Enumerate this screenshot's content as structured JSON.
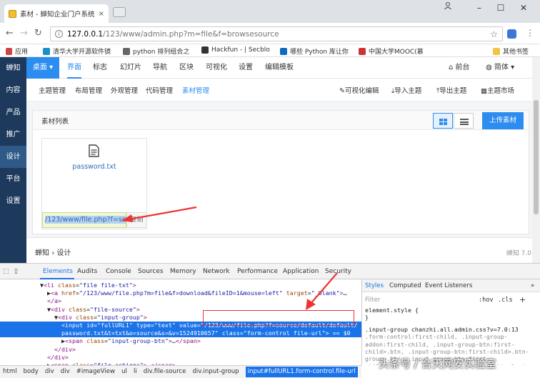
{
  "browser": {
    "tab_title": "素材 - 蝉知企业门户系统",
    "tab_close": "×",
    "url_host": "127.0.0.1",
    "url_path": "/123/www/admin.php?m=file&f=browsesource",
    "win_min": "–",
    "win_max": "☐",
    "win_close": "✕",
    "bookmarks": [
      "应用",
      "清华大学开源软件镜",
      "python 排列组合之",
      "Hackfun - | Secblo",
      "哪些 Python 库让你",
      "中国大学MOOC(慕",
      "其他书签"
    ]
  },
  "sidebar": {
    "brand": "蝉知",
    "items": [
      "内容",
      "产品",
      "推广",
      "设计",
      "平台",
      "设置"
    ]
  },
  "topnav": {
    "brand_tab": "桌面 ▾",
    "items": [
      "界面",
      "标志",
      "幻灯片",
      "导航",
      "区块",
      "可视化",
      "设置",
      "编辑模板"
    ],
    "front": "前台",
    "lang": "简体 ▾"
  },
  "subnav": {
    "items": [
      "主题管理",
      "布局管理",
      "外观管理",
      "代码管理",
      "素材管理"
    ],
    "actions": [
      "可视化编辑",
      "导入主题",
      "导出主题",
      "主题市场"
    ]
  },
  "panel": {
    "title": "素材列表",
    "upload": "上传素材",
    "file_name": "password.txt",
    "file_url": "/123/www/file.php?f=so",
    "copy": "复制"
  },
  "footer": {
    "crumb_brand": "蝉知",
    "crumb_sep": "›",
    "crumb_page": "设计",
    "version": "蝉知 7.0"
  },
  "devtools": {
    "tabs": [
      "Elements",
      "Audits",
      "Console",
      "Sources",
      "Memory",
      "Network",
      "Performance",
      "Application",
      "Security"
    ],
    "lines": [
      {
        "i": 0,
        "parts": [
          [
            "tx",
            "▼"
          ],
          [
            "tg",
            "<li "
          ],
          [
            "an",
            "class"
          ],
          [
            "tx",
            "="
          ],
          [
            "av",
            "\"file file-txt\""
          ],
          [
            "tg",
            ">"
          ]
        ]
      },
      {
        "i": 1,
        "parts": [
          [
            "tx",
            "▶"
          ],
          [
            "tg",
            "<a "
          ],
          [
            "an",
            "href"
          ],
          [
            "tx",
            "="
          ],
          [
            "av",
            "\"/123/www/file.php?m=file&f=download&fileID=1&mouse=left\""
          ],
          [
            "an",
            " target"
          ],
          [
            "tx",
            "="
          ],
          [
            "av",
            "\"_blank\""
          ],
          [
            "tg",
            ">"
          ],
          [
            "tx",
            "…"
          ]
        ]
      },
      {
        "i": 1,
        "parts": [
          [
            "tg",
            "</a>"
          ]
        ]
      },
      {
        "i": 1,
        "parts": [
          [
            "tx",
            "▼"
          ],
          [
            "tg",
            "<div "
          ],
          [
            "an",
            "class"
          ],
          [
            "tx",
            "="
          ],
          [
            "av",
            "\"file-source\""
          ],
          [
            "tg",
            ">"
          ]
        ]
      },
      {
        "i": 2,
        "parts": [
          [
            "tx",
            "▼"
          ],
          [
            "tg",
            "<div "
          ],
          [
            "an",
            "class"
          ],
          [
            "tx",
            "="
          ],
          [
            "av",
            "\"input-group\""
          ],
          [
            "tg",
            ">"
          ]
        ]
      },
      {
        "i": 3,
        "parts": [
          [
            "tg",
            "<input "
          ],
          [
            "an",
            "id"
          ],
          [
            "tx",
            "="
          ],
          [
            "av",
            "\"fullURL1\""
          ],
          [
            "an",
            " type"
          ],
          [
            "tx",
            "="
          ],
          [
            "av",
            "\"text\""
          ],
          [
            "an",
            " value"
          ],
          [
            "tx",
            "="
          ],
          [
            "av",
            "\"/123/www/file.php?f=source/default/default/"
          ]
        ],
        "sel": true
      },
      {
        "i": 3,
        "parts": [
          [
            "av",
            "password.txt&t=txt&o=source&s=&v=1524910657\""
          ],
          [
            "an",
            " class"
          ],
          [
            "tx",
            "="
          ],
          [
            "av",
            "\"form-control file-url\""
          ],
          [
            "tx",
            "> == $0"
          ]
        ],
        "sel": true
      },
      {
        "i": 3,
        "parts": [
          [
            "tx",
            "▶"
          ],
          [
            "tg",
            "<span "
          ],
          [
            "an",
            "class"
          ],
          [
            "tx",
            "="
          ],
          [
            "av",
            "\"input-group-btn\""
          ],
          [
            "tg",
            ">"
          ],
          [
            "tx",
            "…"
          ],
          [
            "tg",
            "</span>"
          ]
        ]
      },
      {
        "i": 2,
        "parts": [
          [
            "tg",
            "</div>"
          ]
        ]
      },
      {
        "i": 1,
        "parts": [
          [
            "tg",
            "</div>"
          ]
        ]
      },
      {
        "i": 1,
        "parts": [
          [
            "tx",
            "▶"
          ],
          [
            "tg",
            "<span "
          ],
          [
            "an",
            "class"
          ],
          [
            "tx",
            "="
          ],
          [
            "av",
            "\"file-actions\""
          ],
          [
            "tg",
            ">"
          ],
          [
            "tx",
            "…"
          ],
          [
            "tg",
            "</span>"
          ]
        ]
      },
      {
        "i": 0,
        "parts": [
          [
            "tg",
            "</li>"
          ]
        ]
      }
    ],
    "styles_tabs": [
      "Styles",
      "Computed",
      "Event Listeners"
    ],
    "styles_more": "»",
    "filter_placeholder": "Filter",
    "hov": ":hov",
    "cls": ".cls",
    "plus": "+",
    "style_lines": [
      "element.style {",
      "}",
      ".input-group     chanzhi.all.admin.css?v=7.0:13",
      ".form-control:first-child, .input-group-",
      "addon:first-child, .input-group-btn:first-",
      "child>.btn, .input-group-btn:first-child>.btn-",
      "group>.btn, .input-group-btn:first-",
      "child>.dropdown-toggle, .input-group-btn:last-",
      "child>.btn:not(:last-child):not(.dropdown-"
    ],
    "breadcrumbs": [
      "html",
      "body",
      "div",
      "div",
      "#imageView",
      "ul",
      "li",
      "div.file-source",
      "div.input-group",
      "input#fullURL1.form-control.file-url"
    ]
  },
  "watermark": "头条号 / 合天网安实验室",
  "colors": {
    "accent": "#2d8cf0",
    "sidebar": "#1d3a5c",
    "annotation": "#e33333"
  }
}
